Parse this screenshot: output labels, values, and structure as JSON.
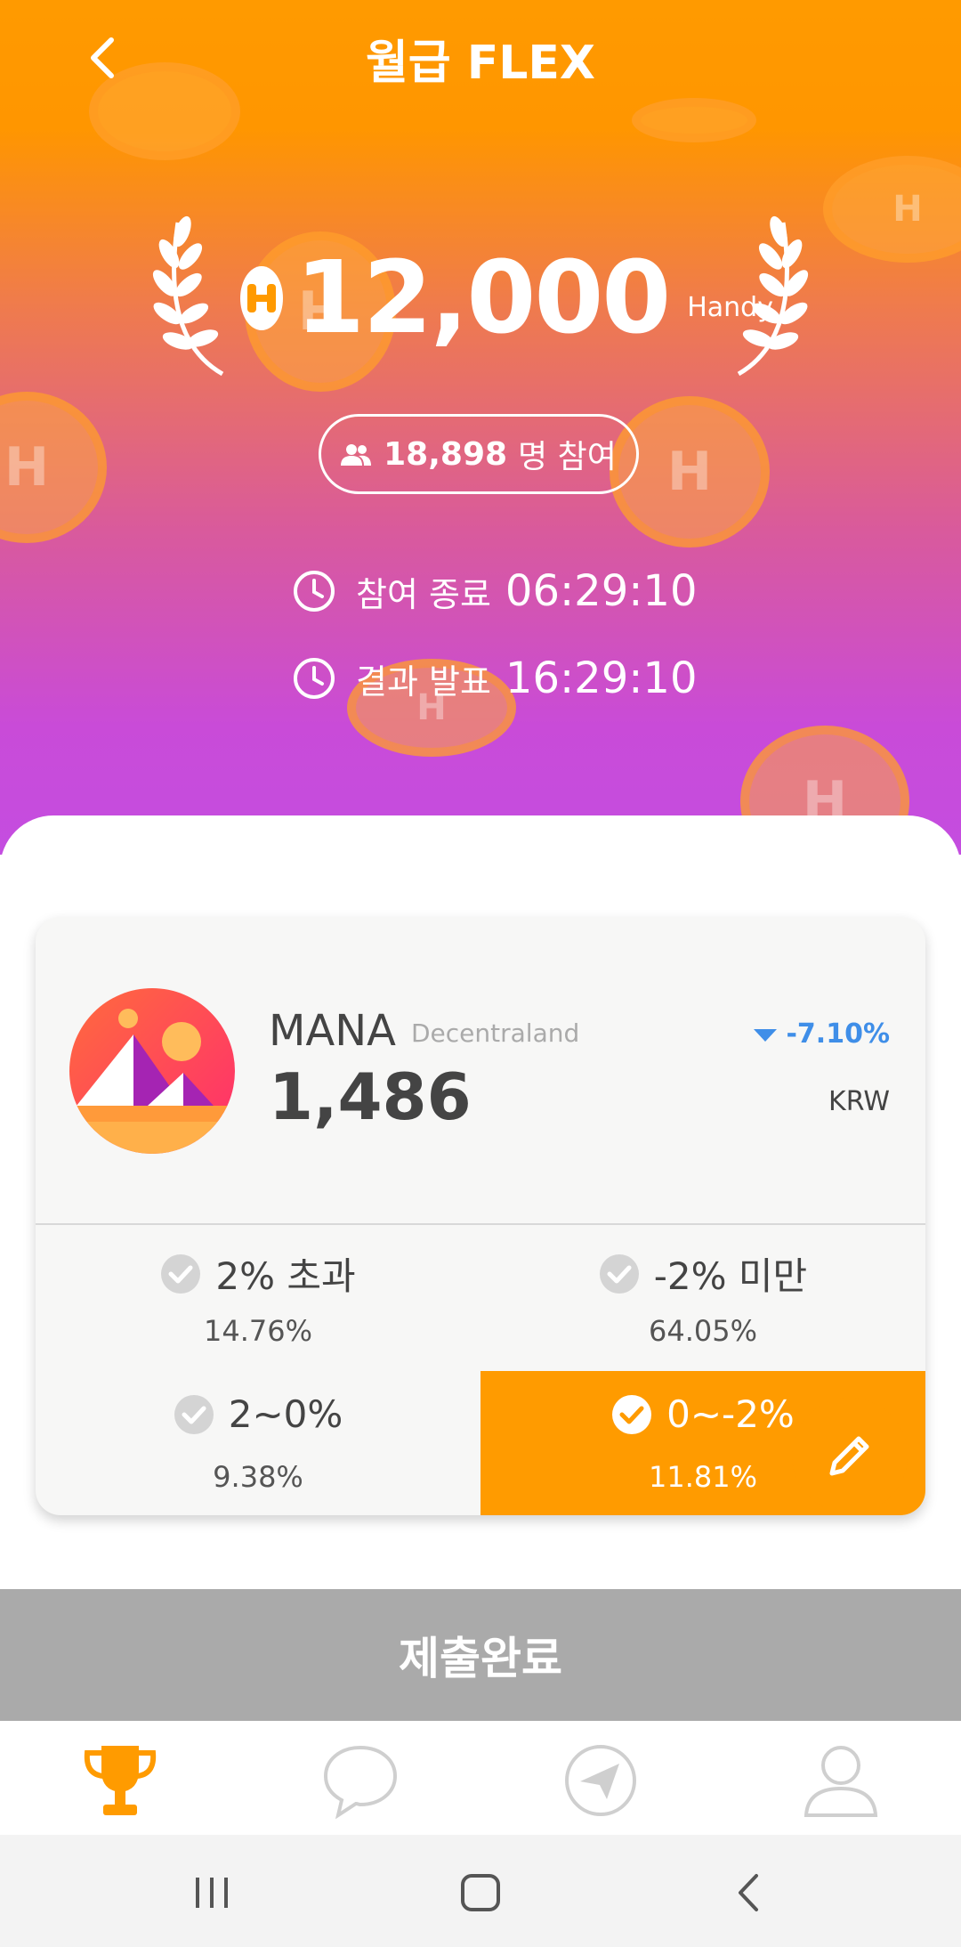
{
  "header": {
    "title": "월급 FLEX"
  },
  "prize": {
    "amount": "12,000",
    "unit": "Handy"
  },
  "participants": {
    "count": "18,898",
    "label": "명 참여"
  },
  "timers": [
    {
      "label": "참여 종료",
      "value": "06:29:10"
    },
    {
      "label": "결과 발표",
      "value": "16:29:10"
    }
  ],
  "coin": {
    "symbol": "MANA",
    "name": "Decentraland",
    "price": "1,486",
    "change": "-7.10%",
    "currency": "KRW"
  },
  "options": [
    {
      "label": "2% 초과",
      "percent": "14.76%",
      "selected": false
    },
    {
      "label": "-2% 미만",
      "percent": "64.05%",
      "selected": false
    },
    {
      "label": "2~0%",
      "percent": "9.38%",
      "selected": false
    },
    {
      "label": "0~-2%",
      "percent": "11.81%",
      "selected": true
    }
  ],
  "submit": {
    "label": "제출완료"
  },
  "tabs": [
    {
      "icon": "trophy-icon",
      "active": true
    },
    {
      "icon": "chat-bubble-icon",
      "active": false
    },
    {
      "icon": "paper-plane-icon",
      "active": false
    },
    {
      "icon": "user-icon",
      "active": false
    }
  ],
  "colors": {
    "accent": "#ff9b00",
    "gradient_top": "#ff9a00",
    "gradient_bottom": "#c44de0",
    "negative_change": "#3f8ee8",
    "submit_disabled": "#aaaaaa"
  }
}
